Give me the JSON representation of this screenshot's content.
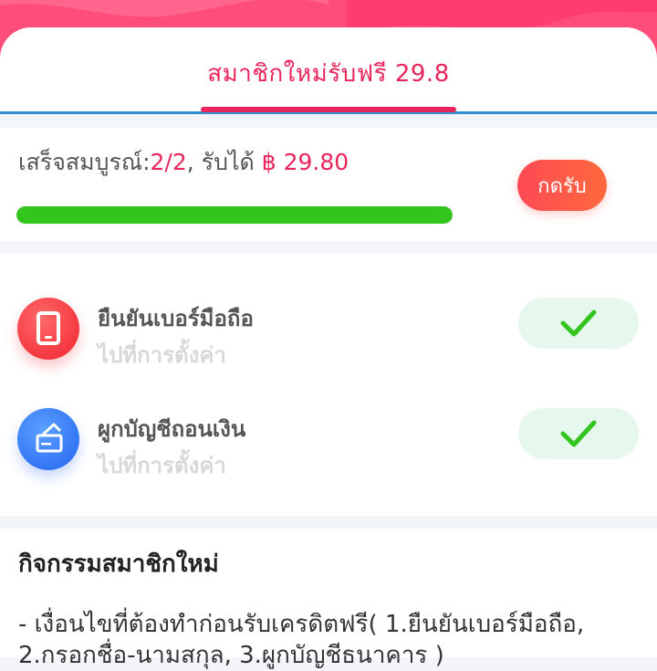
{
  "tab": {
    "title": "สมาชิกใหม่รับฟรี 29.8"
  },
  "progress": {
    "label_prefix": "เสร็จสมบูรณ์:",
    "count": "2/2",
    "separator": ", รับได้ ",
    "amount": "฿ 29.80",
    "fraction": 1.0,
    "claim_label": "กดรับ"
  },
  "tasks": [
    {
      "title": "ยืนยันเบอร์มือถือ",
      "subtitle": "ไปที่การตั้งค่า",
      "icon": "phone-icon",
      "status": "done"
    },
    {
      "title": "ผูกบัญชีถอนเงิน",
      "subtitle": "ไปที่การตั้งค่า",
      "icon": "bank-card-icon",
      "status": "done"
    }
  ],
  "description": {
    "heading": "กิจกรรมสมาชิกใหม่",
    "body": "- เงื่อนไขที่ต้องทำก่อนรับเครดิตฟรี( 1.ยืนยันเบอร์มือถือ, 2.กรอกชื่อ-นามสกุล, 3.ผูกบัญชีธนาคาร )"
  },
  "colors": {
    "accent": "#e8265b",
    "progress_fill": "#33c41d",
    "check": "#33c41d",
    "header_bg": "#ff4d7a"
  }
}
